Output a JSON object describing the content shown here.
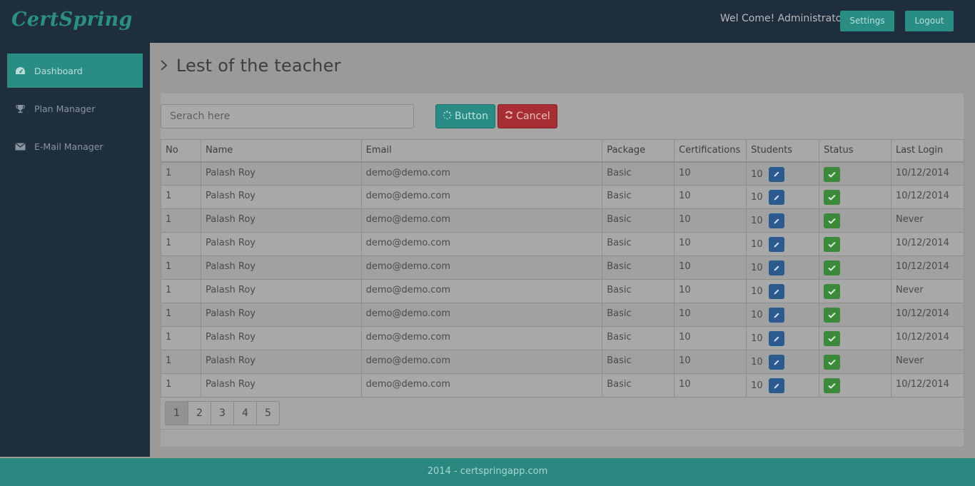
{
  "app": {
    "logo": "CertSpring"
  },
  "header": {
    "welcome": "Wel Come! Administrator",
    "settings_label": "Settings",
    "logout_label": "Logout"
  },
  "sidebar": {
    "items": [
      {
        "label": "Dashboard",
        "icon": "dashboard-icon",
        "active": true
      },
      {
        "label": "Plan Manager",
        "icon": "trophy-icon"
      },
      {
        "label": "E-Mail Manager",
        "icon": "envelope-icon"
      }
    ]
  },
  "main": {
    "title": "Lest of the teacher",
    "search_placeholder": "Serach here",
    "button_label": "Button",
    "cancel_label": "Cancel"
  },
  "table": {
    "columns": [
      "No",
      "Name",
      "Email",
      "Package",
      "Certifications",
      "Students",
      "Status",
      "Last Login"
    ],
    "rows": [
      {
        "no": "1",
        "name": "Palash Roy",
        "email": "demo@demo.com",
        "package": "Basic",
        "certifications": "10",
        "students": "10",
        "last_login": "10/12/2014"
      },
      {
        "no": "1",
        "name": "Palash Roy",
        "email": "demo@demo.com",
        "package": "Basic",
        "certifications": "10",
        "students": "10",
        "last_login": "10/12/2014"
      },
      {
        "no": "1",
        "name": "Palash Roy",
        "email": "demo@demo.com",
        "package": "Basic",
        "certifications": "10",
        "students": "10",
        "last_login": "Never"
      },
      {
        "no": "1",
        "name": "Palash Roy",
        "email": "demo@demo.com",
        "package": "Basic",
        "certifications": "10",
        "students": "10",
        "last_login": "10/12/2014"
      },
      {
        "no": "1",
        "name": "Palash Roy",
        "email": "demo@demo.com",
        "package": "Basic",
        "certifications": "10",
        "students": "10",
        "last_login": "10/12/2014"
      },
      {
        "no": "1",
        "name": "Palash Roy",
        "email": "demo@demo.com",
        "package": "Basic",
        "certifications": "10",
        "students": "10",
        "last_login": "Never"
      },
      {
        "no": "1",
        "name": "Palash Roy",
        "email": "demo@demo.com",
        "package": "Basic",
        "certifications": "10",
        "students": "10",
        "last_login": "10/12/2014"
      },
      {
        "no": "1",
        "name": "Palash Roy",
        "email": "demo@demo.com",
        "package": "Basic",
        "certifications": "10",
        "students": "10",
        "last_login": "10/12/2014"
      },
      {
        "no": "1",
        "name": "Palash Roy",
        "email": "demo@demo.com",
        "package": "Basic",
        "certifications": "10",
        "students": "10",
        "last_login": "Never"
      },
      {
        "no": "1",
        "name": "Palash Roy",
        "email": "demo@demo.com",
        "package": "Basic",
        "certifications": "10",
        "students": "10",
        "last_login": "10/12/2014"
      }
    ]
  },
  "pagination": {
    "pages": [
      "1",
      "2",
      "3",
      "4",
      "5"
    ],
    "current": "1"
  },
  "footer": {
    "text": "2014 - certspringapp.com"
  },
  "colors": {
    "accent": "#2a8d83",
    "danger": "#a82e33",
    "edit": "#2a5a8e",
    "status_ok": "#3a8a3a",
    "sidebar": "#1f2e3c"
  }
}
